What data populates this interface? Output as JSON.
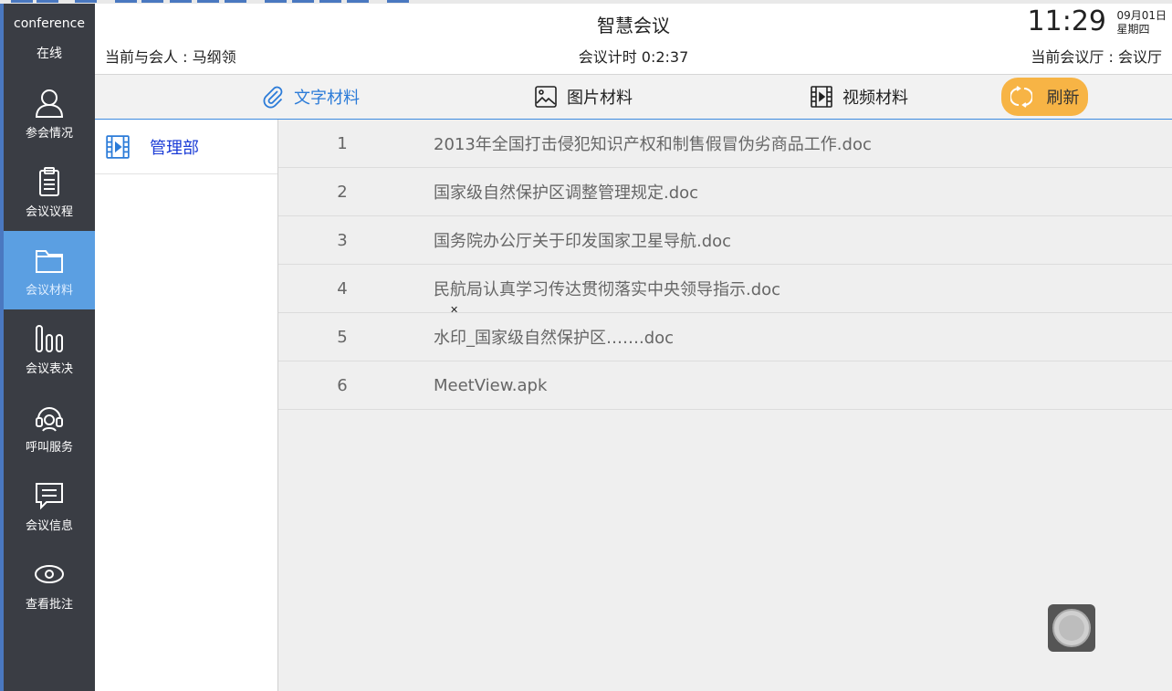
{
  "sidebar": {
    "brand": "conference",
    "status": "在线",
    "items": [
      {
        "label": "参会情况",
        "icon": "user-icon"
      },
      {
        "label": "会议议程",
        "icon": "clipboard-icon"
      },
      {
        "label": "会议材料",
        "icon": "folder-icon",
        "active": true
      },
      {
        "label": "会议表决",
        "icon": "bar-chart-icon"
      },
      {
        "label": "呼叫服务",
        "icon": "headset-icon"
      },
      {
        "label": "会议信息",
        "icon": "message-icon"
      },
      {
        "label": "查看批注",
        "icon": "eye-icon"
      }
    ]
  },
  "header": {
    "title": "智慧会议",
    "attendee": "当前与会人 : 马纲领",
    "timer": "会议计时  0:2:37",
    "time": "11:29",
    "date": "09月01日",
    "weekday": "星期四",
    "hall": "当前会议厅 : 会议厅"
  },
  "tabs": [
    {
      "label": "文字材料",
      "icon": "paperclip-icon",
      "active": true
    },
    {
      "label": "图片材料",
      "icon": "image-icon"
    },
    {
      "label": "视频材料",
      "icon": "film-icon"
    }
  ],
  "refresh_label": "刷新",
  "folders": [
    {
      "label": "管理部",
      "icon": "film-icon"
    }
  ],
  "files": [
    {
      "index": "1",
      "name": "2013年全国打击侵犯知识产权和制售假冒伪劣商品工作.doc"
    },
    {
      "index": "2",
      "name": "国家级自然保护区调整管理规定.doc"
    },
    {
      "index": "3",
      "name": "国务院办公厅关于印发国家卫星导航.doc"
    },
    {
      "index": "4",
      "name": "民航局认真学习传达贯彻落实中央领导指示.doc"
    },
    {
      "index": "5",
      "name": "水印_国家级自然保护区…….doc"
    },
    {
      "index": "6",
      "name": "MeetView.apk"
    }
  ],
  "colors": {
    "sidebar_bg": "#3a3d44",
    "active_nav": "#5b9fe2",
    "tab_active": "#2b7bd8",
    "refresh_bg": "#f7b445",
    "folder_text": "#1a3bd6"
  }
}
